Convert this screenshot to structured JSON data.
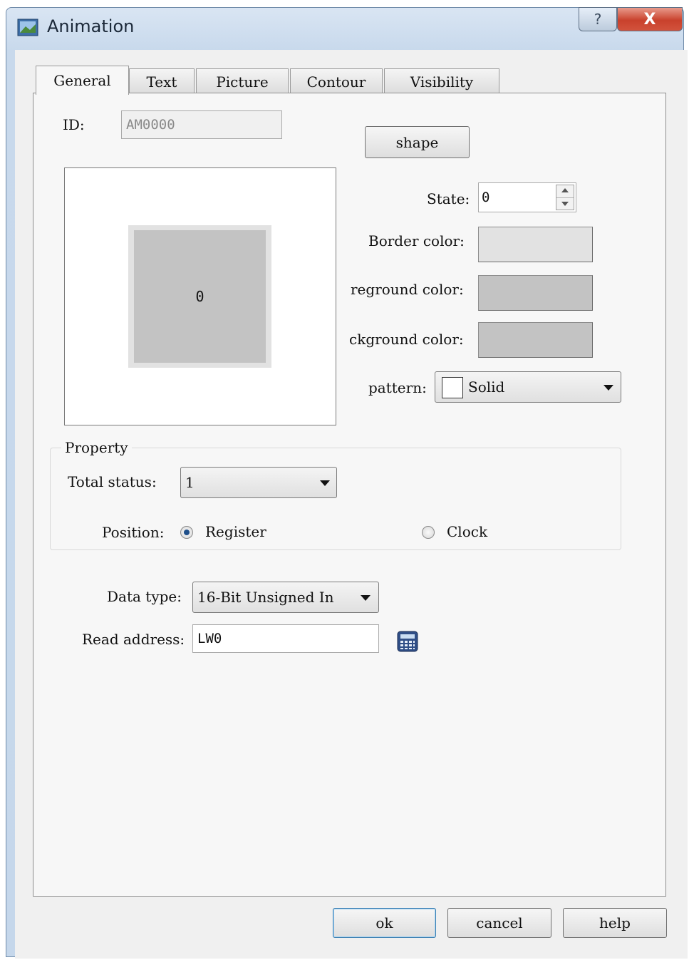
{
  "window": {
    "title": "Animation",
    "help_glyph": "?",
    "close_glyph": "X"
  },
  "tabs": [
    {
      "label": "General",
      "active": true
    },
    {
      "label": "Text"
    },
    {
      "label": "Picture"
    },
    {
      "label": "Contour"
    },
    {
      "label": "Visibility"
    }
  ],
  "general": {
    "id_label": "ID:",
    "id_value": "AM0000",
    "shape_button": "shape",
    "preview_value": "0",
    "state_label": "State:",
    "state_value": "0",
    "border_color_label": "Border color:",
    "border_color": "#e2e2e2",
    "foreground_color_label": "reground color:",
    "foreground_color": "#c3c3c3",
    "background_color_label": "ckground color:",
    "background_color": "#c3c3c3",
    "pattern_label": "pattern:",
    "pattern_value": "Solid"
  },
  "property": {
    "legend": "Property",
    "total_status_label": "Total status:",
    "total_status_value": "1",
    "position_label": "Position:",
    "register_label": "Register",
    "clock_label": "Clock",
    "selected": "Register"
  },
  "address": {
    "data_type_label": "Data type:",
    "data_type_value": "16-Bit Unsigned In",
    "read_address_label": "Read address:",
    "read_address_value": "LW0",
    "calculator_icon": "calculator-icon"
  },
  "footer": {
    "ok": "ok",
    "cancel": "cancel",
    "help": "help"
  }
}
